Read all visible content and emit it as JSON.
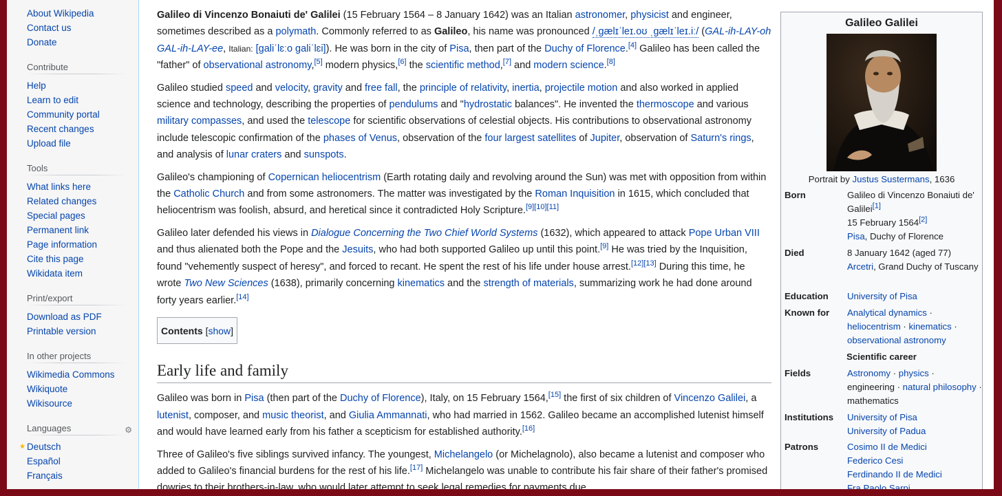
{
  "sidebar": {
    "top_links": [
      "About Wikipedia",
      "Contact us",
      "Donate"
    ],
    "contribute": {
      "title": "Contribute",
      "links": [
        "Help",
        "Learn to edit",
        "Community portal",
        "Recent changes",
        "Upload file"
      ]
    },
    "tools": {
      "title": "Tools",
      "links": [
        "What links here",
        "Related changes",
        "Special pages",
        "Permanent link",
        "Page information",
        "Cite this page",
        "Wikidata item"
      ]
    },
    "printexport": {
      "title": "Print/export",
      "links": [
        "Download as PDF",
        "Printable version"
      ]
    },
    "other_projects": {
      "title": "In other projects",
      "links": [
        "Wikimedia Commons",
        "Wikiquote",
        "Wikisource"
      ]
    },
    "languages": {
      "title": "Languages",
      "links": [
        "Deutsch",
        "Español",
        "Français"
      ]
    }
  },
  "article": {
    "p1": {
      "name_bold": "Galileo di Vincenzo Bonaiuti de' Galilei",
      "t1": " (15 February 1564 – 8 January 1642) was an Italian ",
      "l_astronomer": "astronomer",
      "t2": ", ",
      "l_physicist": "physicist",
      "t3": " and engineer, sometimes described as a ",
      "l_polymath": "polymath",
      "t4": ". Commonly referred to as ",
      "galileo_bold": "Galileo",
      "t5": ", his name was pronounced ",
      "ipa": "/ˌɡælɪˈleɪ.oʊ ˌɡælɪˈleɪ.iː/",
      "t6": " (",
      "respell": "GAL-ih-LAY-oh GAL-ih-LAY-ee",
      "t7": ", ",
      "italian_lbl": "Italian:",
      "t8": " ",
      "ipa_it": "[ɡaliˈlɛːo ɡaliˈlɛi]",
      "t9": "). He was born in the city of ",
      "l_pisa": "Pisa",
      "t10": ", then part of the ",
      "l_duchy": "Duchy of Florence",
      "r4": "[4]",
      "t11": " Galileo has been called the \"father\" of ",
      "l_obsastro": "observational astronomy",
      "r5": "[5]",
      "t12": " modern physics,",
      "r6": "[6]",
      "t13": " the ",
      "l_scimethod": "scientific method",
      "r7": "[7]",
      "t14": " and ",
      "l_modsci": "modern science",
      "t15": ".",
      "r8": "[8]"
    },
    "p2": {
      "t1": "Galileo studied ",
      "l_speed": "speed",
      "t2": " and ",
      "l_velocity": "velocity",
      "t3": ", ",
      "l_gravity": "gravity",
      "t4": " and ",
      "l_freefall": "free fall",
      "t5": ", the ",
      "l_relativity": "principle of relativity",
      "t6": ", ",
      "l_inertia": "inertia",
      "t7": ", ",
      "l_projectile": "projectile motion",
      "t8": " and also worked in applied science and technology, describing the properties of ",
      "l_pendulums": "pendulums",
      "t9": " and \"",
      "l_hydrostatic": "hydrostatic",
      "t10": " balances\". He invented the ",
      "l_thermoscope": "thermoscope",
      "t11": " and various ",
      "l_compasses": "military compasses",
      "t12": ", and used the ",
      "l_telescope": "telescope",
      "t13": " for scientific observations of celestial objects. His contributions to observational astronomy include telescopic confirmation of the ",
      "l_venus": "phases of Venus",
      "t14": ", observation of the ",
      "l_satellites": "four largest satellites",
      "t15": " of ",
      "l_jupiter": "Jupiter",
      "t16": ", observation of ",
      "l_rings": "Saturn's rings",
      "t17": ", and analysis of ",
      "l_craters": "lunar craters",
      "t18": " and ",
      "l_sunspots": "sunspots",
      "t19": "."
    },
    "p3": {
      "t1": "Galileo's championing of ",
      "l_helio": "Copernican heliocentrism",
      "t2": " (Earth rotating daily and revolving around the Sun) was met with opposition from within the ",
      "l_church": "Catholic Church",
      "t3": " and from some astronomers. The matter was investigated by the ",
      "l_inquisition": "Roman Inquisition",
      "t4": " in 1615, which concluded that heliocentrism was foolish, absurd, and heretical since it contradicted Holy Scripture.",
      "refs": "[9][10][11]"
    },
    "p4": {
      "t1": "Galileo later defended his views in ",
      "l_dialogue": "Dialogue Concerning the Two Chief World Systems",
      "t2": " (1632), which appeared to attack ",
      "l_pope": "Pope Urban VIII",
      "t3": " and thus alienated both the Pope and the ",
      "l_jesuits": "Jesuits",
      "t4": ", who had both supported Galileo up until this point.",
      "r9": "[9]",
      "t5": " He was tried by the Inquisition, found \"vehemently suspect of heresy\", and forced to recant. He spent the rest of his life under house arrest.",
      "r12": "[12][13]",
      "t6": " During this time, he wrote ",
      "l_twonew": "Two New Sciences",
      "t7": " (1638), primarily concerning ",
      "l_kinematics": "kinematics",
      "t8": " and the ",
      "l_strength": "strength of materials",
      "t9": ", summarizing work he had done around forty years earlier.",
      "r14": "[14]"
    },
    "toc": {
      "label": "Contents",
      "open": "[",
      "show": "show",
      "close": "]"
    },
    "section_heading": "Early life and family",
    "p5": {
      "t1": "Galileo was born in ",
      "l_pisa": "Pisa",
      "t2": " (then part of the ",
      "l_duchy": "Duchy of Florence",
      "t3": "), Italy, on 15 February 1564,",
      "r15": "[15]",
      "t4": " the first of six children of ",
      "l_vincenzo": "Vincenzo Galilei",
      "t5": ", a ",
      "l_lutenist": "lutenist",
      "t6": ", composer, and ",
      "l_theorist": "music theorist",
      "t7": ", and ",
      "l_giulia": "Giulia Ammannati",
      "t8": ", who had married in 1562. Galileo became an accomplished lutenist himself and would have learned early from his father a scepticism for established authority.",
      "r16": "[16]"
    },
    "p6": {
      "t1": "Three of Galileo's five siblings survived infancy. The youngest, ",
      "l_michelangelo": "Michelangelo",
      "t2": " (or Michelagnolo), also became a lutenist and composer who added to Galileo's financial burdens for the rest of his life.",
      "r17": "[17]",
      "t3": " Michelangelo was unable to contribute his fair share of their father's promised dowries to their brothers-in-law, who would later attempt to seek legal remedies for payments due."
    }
  },
  "infobox": {
    "title": "Galileo Galilei",
    "caption_pre": "Portrait by ",
    "caption_link": "Justus Sustermans",
    "caption_post": ", 1636",
    "born_label": "Born",
    "born_name": "Galileo di Vincenzo Bonaiuti de' Galilei",
    "born_ref1": "[1]",
    "born_date": "15 February 1564",
    "born_ref2": "[2]",
    "born_place_link": "Pisa",
    "born_place_rest": ", Duchy of Florence",
    "died_label": "Died",
    "died_date": "8 January 1642 (aged 77)",
    "died_place_link": "Arcetri",
    "died_place_rest": ", Grand Duchy of Tuscany",
    "education_label": "Education",
    "education": "University of Pisa",
    "known_label": "Known for",
    "known_1": "Analytical dynamics",
    "known_2": "heliocentrism",
    "known_3": "kinematics",
    "known_4": "observational astronomy",
    "career_header": "Scientific career",
    "fields_label": "Fields",
    "fields_1": "Astronomy",
    "fields_2": "physics",
    "fields_3": "engineering",
    "fields_4": "natural philosophy",
    "fields_5": "mathematics",
    "sep": " · ",
    "institutions_label": "Institutions",
    "inst_1": "University of Pisa",
    "inst_2": "University of Padua",
    "patrons_label": "Patrons",
    "patron_1": "Cosimo II de Medici",
    "patron_2": "Federico Cesi",
    "patron_3": "Ferdinando II de Medici",
    "patron_4": "Fra Paolo Sarpi"
  }
}
